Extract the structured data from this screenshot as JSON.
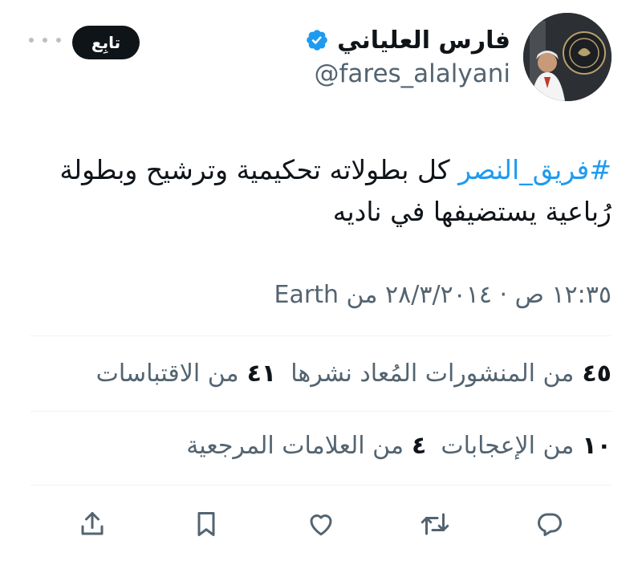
{
  "author": {
    "display_name": "فارس العلياني",
    "handle": "@fares_alalyani",
    "verified": true
  },
  "follow_label": "تابِع",
  "tweet": {
    "hashtag": "#فريق_النصر",
    "text": " كل بطولاته تحكيمية وترشيح وبطولة رُباعية يستضيفها في ناديه"
  },
  "meta": {
    "timestamp": "١٢:٣٥ ص · ٢٨/٣/٢٠١٤ من",
    "source": "Earth"
  },
  "stats": {
    "reposts_count": "٤٥",
    "reposts_label": "من المنشورات المُعاد نشرها",
    "quotes_count": "٤١",
    "quotes_label": "من الاقتباسات",
    "likes_count": "١٠",
    "likes_label": "من الإعجابات",
    "bookmarks_count": "٤",
    "bookmarks_label": "من العلامات المرجعية"
  },
  "colors": {
    "accent": "#1d9bf0",
    "text": "#0f1419",
    "secondary": "#536471",
    "divider": "#eff3f4"
  },
  "icons": [
    "more-icon",
    "verified-badge-icon",
    "share-icon",
    "bookmark-icon",
    "like-icon",
    "repost-icon",
    "reply-icon"
  ]
}
